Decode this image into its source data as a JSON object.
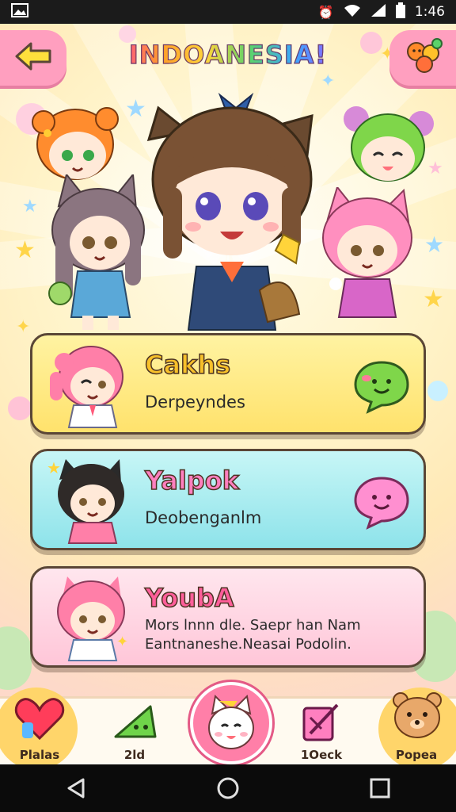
{
  "status_bar": {
    "time": "1:46",
    "icons": [
      "gallery-icon",
      "alarm-icon",
      "wifi-icon",
      "signal-icon",
      "battery-icon"
    ]
  },
  "header": {
    "title": "INDOANESIA!",
    "back_icon": "arrow-left-icon",
    "menu_icon": "character-group-icon"
  },
  "cards": [
    {
      "title": "Cakhs",
      "description": "Derpeyndes",
      "bubble_icon": "green-chat-bubble-icon",
      "color": "#ffe26c"
    },
    {
      "title": "Yalpok",
      "description": "Deobenganlm",
      "bubble_icon": "pink-chat-bubble-icon",
      "color": "#8ee3ea"
    },
    {
      "title": "YoubA",
      "description_line1": "Mors lnnn dle. Saepr han Nam",
      "description_line2": "Eantnaneshe.Neasai Podolin.",
      "bubble_icon": "none",
      "color": "#ffc6d8"
    }
  ],
  "bottom_nav": {
    "items": [
      {
        "label": "Plalas",
        "icon": "heart-icon"
      },
      {
        "label": "2ld",
        "icon": "triangle-icon"
      },
      {
        "label": "",
        "icon": "cat-icon"
      },
      {
        "label": "1Oeck",
        "icon": "flag-icon"
      },
      {
        "label": "Popea",
        "icon": "bear-icon"
      }
    ]
  },
  "system_nav": {
    "back_icon": "android-back-icon",
    "home_icon": "android-home-icon",
    "recents_icon": "android-recents-icon"
  },
  "colors": {
    "accent_pink": "#ff9fbf",
    "card_border": "#5a4636",
    "background": "#fff3c8"
  }
}
